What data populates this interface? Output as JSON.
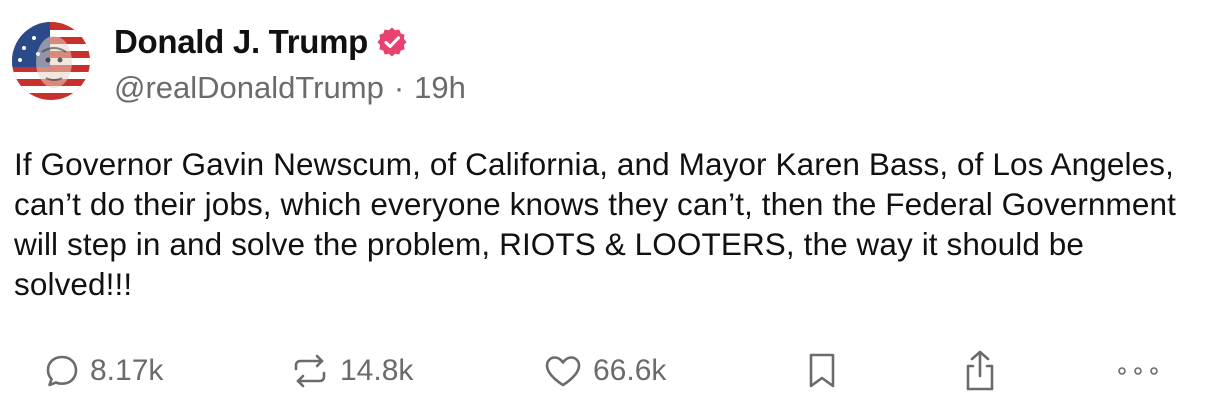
{
  "author": {
    "display_name": "Donald J. Trump",
    "handle": "@realDonaldTrump",
    "separator": "·",
    "timestamp": "19h",
    "verified_color": "#e8436e"
  },
  "post": {
    "text": "If Governor Gavin Newscum, of California, and Mayor Karen Bass, of Los Angeles, can’t do their jobs, which everyone knows they can’t, then the Federal Government will step in and solve the problem, RIOTS & LOOTERS, the way it should be solved!!!"
  },
  "actions": {
    "reply": {
      "icon": "reply-icon",
      "count": "8.17k"
    },
    "repost": {
      "icon": "repost-icon",
      "count": "14.8k"
    },
    "like": {
      "icon": "heart-icon",
      "count": "66.6k"
    },
    "bookmark": {
      "icon": "bookmark-icon"
    },
    "share": {
      "icon": "share-icon"
    },
    "more": {
      "icon": "more-icon"
    }
  },
  "colors": {
    "text": "#111111",
    "muted": "#6b6b6b",
    "verified": "#e8436e"
  }
}
